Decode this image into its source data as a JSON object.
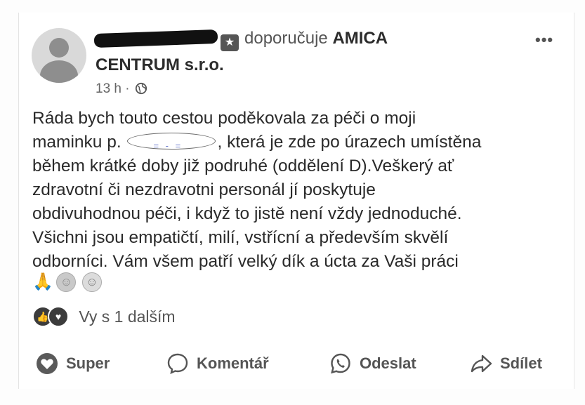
{
  "post": {
    "author_name": "",
    "action_text": "doporučuje",
    "page_name_line1": "AMICA",
    "page_name_line2": "CENTRUM s.r.o.",
    "time": "13 h ·",
    "more_label": "•••",
    "text_lines": {
      "l1": "Ráda bych touto cestou poděkovala za péči o moji",
      "l2a": "maminku p.",
      "l2b": ", která je zde po úrazech umístěna",
      "l3": "během krátké doby již podruhé (oddělení D).Veškerý ať",
      "l4": "zdravotní či nezdravotni personál jí poskytuje",
      "l5": "obdivuhodnou péči, i když to jistě není vždy jednoduché.",
      "l6": "Všichni jsou empatičtí, milí, vstřícní a především skvělí",
      "l7": "odborníci. Vám všem patří velký dík a úcta za Vaši  práci"
    },
    "emoji_icons": [
      "praying-hands-icon",
      "smiling-face-icon",
      "smiling-face-icon"
    ]
  },
  "reactions": {
    "icons": [
      "like-icon",
      "love-icon"
    ],
    "summary": "Vy s 1 dalším"
  },
  "actions": {
    "like": "Super",
    "comment": "Komentář",
    "send": "Odeslat",
    "share": "Sdílet"
  }
}
